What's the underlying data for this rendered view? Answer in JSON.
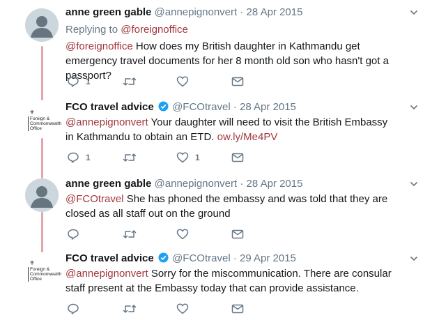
{
  "colors": {
    "mention": "#a2383d",
    "thread_line": "#e2a6a8",
    "muted": "#657786",
    "verified": "#1da1f2"
  },
  "icons": {
    "reply": "reply-icon",
    "retweet": "retweet-icon",
    "like": "heart-icon",
    "dm": "envelope-icon",
    "more": "chevron-down-icon",
    "verified": "verified-badge-icon",
    "avatar_default": "default-avatar-icon",
    "crest": "royal-crest-icon"
  },
  "tweets": [
    {
      "name": "anne green gable",
      "handle": "@annepignonvert",
      "dot": "·",
      "date": "28 Apr 2015",
      "replying_label": "Replying to",
      "replying_to": "@foreignoffice",
      "mention": "@foreignoffice",
      "text": " How does my British daughter in Kathmandu get emergency travel documents for her 8 month old son who hasn't got a passport?",
      "reply_count": "1",
      "like_count": ""
    },
    {
      "name": "FCO travel advice",
      "handle": "@FCOtravel",
      "dot": "·",
      "date": "28 Apr 2015",
      "logo_text": "Foreign & Commonwealth Office",
      "mention": "@annepignonvert",
      "text": " Your daughter will need to visit the British Embassy in Kathmandu to obtain an ETD. ",
      "link": "ow.ly/Me4PV",
      "reply_count": "1",
      "like_count": "1"
    },
    {
      "name": "anne green gable",
      "handle": "@annepignonvert",
      "dot": "·",
      "date": "28 Apr 2015",
      "mention": "@FCOtravel",
      "text": " She has phoned the embassy and was told that they are closed as all staff out on the ground",
      "reply_count": "",
      "like_count": ""
    },
    {
      "name": "FCO travel advice",
      "handle": "@FCOtravel",
      "dot": "·",
      "date": "29 Apr 2015",
      "logo_text": "Foreign & Commonwealth Office",
      "mention": "@annepignonvert",
      "text": " Sorry for the miscommunication. There are consular staff present at the Embassy today that can provide assistance.",
      "reply_count": "",
      "like_count": ""
    }
  ]
}
